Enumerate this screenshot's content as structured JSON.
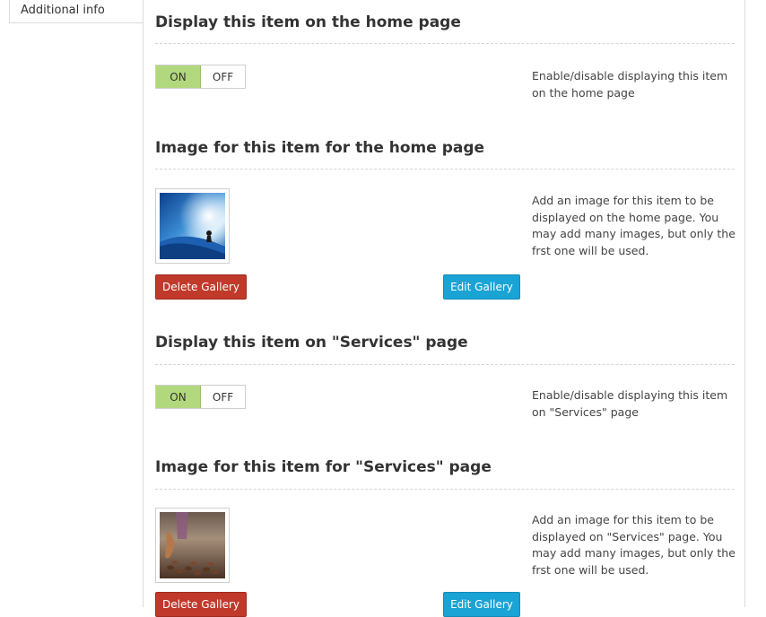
{
  "tab": {
    "label": "Additional info"
  },
  "sections": [
    {
      "title": "Display this item on the home page",
      "toggle": {
        "on": "ON",
        "off": "OFF",
        "state": "on"
      },
      "description": "Enable/disable displaying this item on the home page"
    },
    {
      "title": "Image for this item for the home page",
      "description": "Add an image for this item to be displayed on the home page. You may add many images, but only the frst one will be used.",
      "delete_label": "Delete Gallery",
      "edit_label": "Edit Gallery"
    },
    {
      "title": "Display this item on \"Services\" page",
      "toggle": {
        "on": "ON",
        "off": "OFF",
        "state": "on"
      },
      "description": "Enable/disable displaying this item on \"Services\" page"
    },
    {
      "title": "Image for this item for \"Services\" page",
      "description": "Add an image for this item to be displayed on \"Services\" page. You may add many images, but only the frst one will be used.",
      "delete_label": "Delete Gallery",
      "edit_label": "Edit Gallery"
    }
  ],
  "colors": {
    "toggle_on": "#b2d87e",
    "danger": "#c0392b",
    "info": "#1aa3d5"
  }
}
